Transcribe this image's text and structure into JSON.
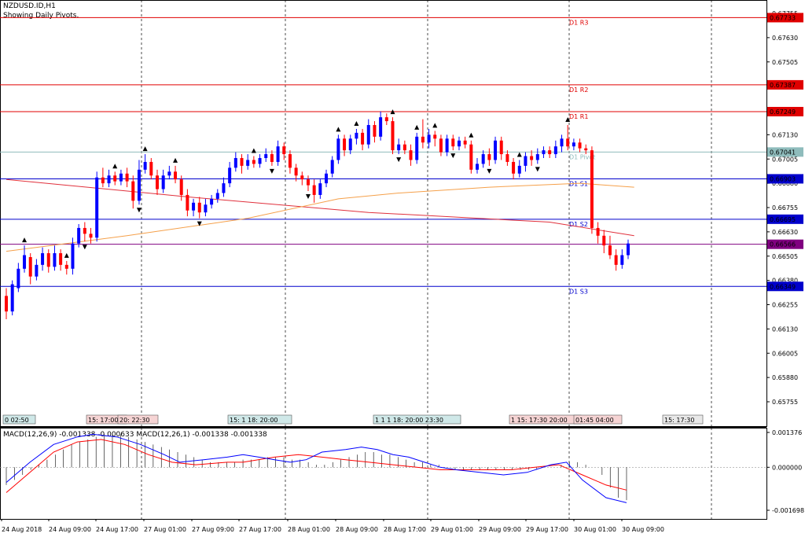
{
  "header": {
    "symbol": "NZDUSD.ID,H1",
    "subtitle": "Showing Daily Pivots.",
    "macd_label": "MACD(12,26,9) -0.001338 -0.000633 MACD(12,26,1) -0.001338 -0.001338"
  },
  "colors": {
    "bull": "#0000ff",
    "bear": "#ff0000",
    "resistance": "#e00000",
    "pivot": "#8fbcbc",
    "support": "#0000cc",
    "current": "#800080",
    "ma_slow": "#e0303c",
    "ma_fast": "#f5a04a",
    "macd_line": "#0000ff",
    "macd_signal": "#ff0000"
  },
  "chart_data": {
    "type": "candlestick",
    "y_ticks": [
      "0.67755",
      "0.67630",
      "0.67505",
      "0.67380",
      "0.67255",
      "0.67130",
      "0.67005",
      "0.66880",
      "0.66755",
      "0.66630",
      "0.66505",
      "0.66380",
      "0.66255",
      "0.66130",
      "0.66005",
      "0.65880",
      "0.65755"
    ],
    "macd_ticks": [
      "0.001376",
      "0.000000",
      "-0.001698"
    ],
    "x_labels": [
      "24 Aug 2018",
      "24 Aug 09:00",
      "24 Aug 17:00",
      "27 Aug 01:00",
      "27 Aug 09:00",
      "27 Aug 17:00",
      "28 Aug 01:00",
      "28 Aug 09:00",
      "28 Aug 17:00",
      "29 Aug 01:00",
      "29 Aug 09:00",
      "29 Aug 17:00",
      "30 Aug 01:00",
      "30 Aug 09:00"
    ],
    "pivots": [
      {
        "name": "D1 R3",
        "value": "0.67733",
        "kind": "resistance"
      },
      {
        "name": "D1 R2",
        "value": "0.67387",
        "kind": "resistance"
      },
      {
        "name": "D1 R1",
        "value": "0.67249",
        "kind": "resistance"
      },
      {
        "name": "D1 Pivot",
        "value": "0.67041",
        "kind": "pivot"
      },
      {
        "name": "D1 S1",
        "value": "0.66903",
        "kind": "support"
      },
      {
        "name": "D1 S2",
        "value": "0.66695",
        "kind": "support"
      },
      {
        "name": "D1 S3",
        "value": "0.66349",
        "kind": "support"
      }
    ],
    "current_price": "0.66566",
    "session_boxes": [
      "0 02:50",
      "15: 17:00",
      "20: 22:30",
      "15: 1 18: 20:00",
      "1 1 1 18: 20:00 23:30",
      "1 15: 17:30 20:00",
      "01:45 04:00",
      "15: 17:30"
    ],
    "candles": [
      [
        0.663,
        0.6622,
        0.6634,
        0.6618
      ],
      [
        0.6622,
        0.6636,
        0.6638,
        0.662
      ],
      [
        0.6634,
        0.6644,
        0.6647,
        0.6632
      ],
      [
        0.6644,
        0.6651,
        0.6656,
        0.6642
      ],
      [
        0.665,
        0.664,
        0.6652,
        0.6636
      ],
      [
        0.664,
        0.6646,
        0.6649,
        0.6638
      ],
      [
        0.6646,
        0.6652,
        0.6655,
        0.6643
      ],
      [
        0.6652,
        0.6645,
        0.6654,
        0.6642
      ],
      [
        0.6645,
        0.6652,
        0.6656,
        0.6643
      ],
      [
        0.6652,
        0.6646,
        0.6654,
        0.6643
      ],
      [
        0.6646,
        0.6644,
        0.6648,
        0.6641
      ],
      [
        0.6644,
        0.6657,
        0.666,
        0.6641
      ],
      [
        0.6657,
        0.6665,
        0.6667,
        0.6655
      ],
      [
        0.6665,
        0.6662,
        0.6668,
        0.6658
      ],
      [
        0.6662,
        0.666,
        0.6665,
        0.6657
      ],
      [
        0.666,
        0.6691,
        0.6694,
        0.6658
      ],
      [
        0.6691,
        0.6688,
        0.6696,
        0.6686
      ],
      [
        0.6688,
        0.6692,
        0.6695,
        0.6686
      ],
      [
        0.6692,
        0.6689,
        0.6694,
        0.6687
      ],
      [
        0.6689,
        0.6693,
        0.6695,
        0.6687
      ],
      [
        0.6693,
        0.6689,
        0.6696,
        0.6686
      ],
      [
        0.6689,
        0.6679,
        0.6692,
        0.6675
      ],
      [
        0.6679,
        0.6695,
        0.67,
        0.6677
      ],
      [
        0.6695,
        0.6699,
        0.6703,
        0.6693
      ],
      [
        0.6699,
        0.6692,
        0.6701,
        0.669
      ],
      [
        0.6692,
        0.6685,
        0.6695,
        0.6682
      ],
      [
        0.6685,
        0.6692,
        0.6695,
        0.6683
      ],
      [
        0.6692,
        0.6694,
        0.6697,
        0.669
      ],
      [
        0.6694,
        0.669,
        0.6697,
        0.6688
      ],
      [
        0.669,
        0.6682,
        0.6692,
        0.6679
      ],
      [
        0.6682,
        0.6674,
        0.6685,
        0.6671
      ],
      [
        0.6674,
        0.6678,
        0.668,
        0.6671
      ],
      [
        0.6678,
        0.6673,
        0.6681,
        0.667
      ],
      [
        0.6673,
        0.6677,
        0.668,
        0.6671
      ],
      [
        0.6677,
        0.668,
        0.6682,
        0.6675
      ],
      [
        0.668,
        0.6683,
        0.6685,
        0.6678
      ],
      [
        0.6683,
        0.6688,
        0.6691,
        0.6681
      ],
      [
        0.6688,
        0.6696,
        0.6699,
        0.6686
      ],
      [
        0.6696,
        0.6701,
        0.6704,
        0.6694
      ],
      [
        0.6701,
        0.6697,
        0.6703,
        0.6693
      ],
      [
        0.6697,
        0.67,
        0.6703,
        0.6695
      ],
      [
        0.67,
        0.6698,
        0.6702,
        0.6696
      ],
      [
        0.6698,
        0.6701,
        0.6703,
        0.6696
      ],
      [
        0.6701,
        0.6703,
        0.6706,
        0.6699
      ],
      [
        0.6703,
        0.6699,
        0.6705,
        0.6697
      ],
      [
        0.6699,
        0.6707,
        0.671,
        0.6697
      ],
      [
        0.6707,
        0.6703,
        0.6709,
        0.67
      ],
      [
        0.6703,
        0.6696,
        0.6705,
        0.6693
      ],
      [
        0.6696,
        0.6692,
        0.6698,
        0.6689
      ],
      [
        0.6692,
        0.669,
        0.6694,
        0.6687
      ],
      [
        0.669,
        0.6687,
        0.6692,
        0.6684
      ],
      [
        0.6687,
        0.6682,
        0.669,
        0.6678
      ],
      [
        0.6682,
        0.6688,
        0.669,
        0.668
      ],
      [
        0.6688,
        0.6693,
        0.6695,
        0.6686
      ],
      [
        0.6693,
        0.67,
        0.6702,
        0.6691
      ],
      [
        0.67,
        0.6711,
        0.6713,
        0.6698
      ],
      [
        0.6711,
        0.6705,
        0.6713,
        0.6702
      ],
      [
        0.6705,
        0.6711,
        0.6713,
        0.6703
      ],
      [
        0.6711,
        0.6714,
        0.6716,
        0.6708
      ],
      [
        0.6714,
        0.6708,
        0.6716,
        0.6705
      ],
      [
        0.6708,
        0.6718,
        0.6721,
        0.6706
      ],
      [
        0.6718,
        0.6712,
        0.672,
        0.6709
      ],
      [
        0.6712,
        0.6722,
        0.6725,
        0.671
      ],
      [
        0.6722,
        0.672,
        0.6724,
        0.6718
      ],
      [
        0.672,
        0.6705,
        0.6722,
        0.6703
      ],
      [
        0.6705,
        0.6708,
        0.6711,
        0.6703
      ],
      [
        0.6708,
        0.6705,
        0.671,
        0.6703
      ],
      [
        0.6705,
        0.67,
        0.6708,
        0.6697
      ],
      [
        0.67,
        0.6712,
        0.6714,
        0.6698
      ],
      [
        0.6712,
        0.6709,
        0.6721,
        0.6706
      ],
      [
        0.6709,
        0.6713,
        0.6716,
        0.6706
      ],
      [
        0.6713,
        0.6711,
        0.6715,
        0.6707
      ],
      [
        0.6711,
        0.6704,
        0.6713,
        0.6702
      ],
      [
        0.6704,
        0.6711,
        0.6713,
        0.6702
      ],
      [
        0.6711,
        0.6707,
        0.6713,
        0.6705
      ],
      [
        0.6707,
        0.671,
        0.6712,
        0.6705
      ],
      [
        0.671,
        0.6708,
        0.6712,
        0.6706
      ],
      [
        0.6708,
        0.6695,
        0.671,
        0.6693
      ],
      [
        0.6695,
        0.6698,
        0.6701,
        0.6693
      ],
      [
        0.6698,
        0.6703,
        0.6705,
        0.6696
      ],
      [
        0.6703,
        0.67,
        0.6706,
        0.6697
      ],
      [
        0.67,
        0.671,
        0.6712,
        0.6698
      ],
      [
        0.671,
        0.6703,
        0.6712,
        0.67
      ],
      [
        0.6703,
        0.6699,
        0.6705,
        0.6697
      ],
      [
        0.6699,
        0.6693,
        0.6701,
        0.669
      ],
      [
        0.6693,
        0.6697,
        0.67,
        0.6691
      ],
      [
        0.6697,
        0.6702,
        0.6704,
        0.6694
      ],
      [
        0.6702,
        0.67,
        0.6705,
        0.6697
      ],
      [
        0.67,
        0.6703,
        0.6706,
        0.6698
      ],
      [
        0.6703,
        0.6705,
        0.6707,
        0.6701
      ],
      [
        0.6705,
        0.6703,
        0.6707,
        0.6701
      ],
      [
        0.6703,
        0.6707,
        0.671,
        0.6701
      ],
      [
        0.6707,
        0.6711,
        0.6713,
        0.6704
      ],
      [
        0.6711,
        0.6707,
        0.6718,
        0.6705
      ],
      [
        0.6707,
        0.6709,
        0.6711,
        0.6705
      ],
      [
        0.6709,
        0.6706,
        0.6711,
        0.6704
      ],
      [
        0.6706,
        0.6705,
        0.6708,
        0.6703
      ],
      [
        0.6705,
        0.6665,
        0.6707,
        0.6662
      ],
      [
        0.6665,
        0.6661,
        0.6668,
        0.6657
      ],
      [
        0.6661,
        0.6656,
        0.6664,
        0.6652
      ],
      [
        0.6656,
        0.6651,
        0.6661,
        0.6649
      ],
      [
        0.6651,
        0.6646,
        0.6654,
        0.6643
      ],
      [
        0.6646,
        0.6651,
        0.6654,
        0.6644
      ],
      [
        0.6651,
        0.6657,
        0.6659,
        0.6649
      ]
    ],
    "fractals": [
      {
        "i": 3,
        "dir": "up"
      },
      {
        "i": 10,
        "dir": "up"
      },
      {
        "i": 13,
        "dir": "down"
      },
      {
        "i": 18,
        "dir": "up"
      },
      {
        "i": 23,
        "dir": "up"
      },
      {
        "i": 22,
        "dir": "down"
      },
      {
        "i": 28,
        "dir": "up"
      },
      {
        "i": 32,
        "dir": "down"
      },
      {
        "i": 41,
        "dir": "up"
      },
      {
        "i": 44,
        "dir": "down"
      },
      {
        "i": 50,
        "dir": "down"
      },
      {
        "i": 55,
        "dir": "up"
      },
      {
        "i": 58,
        "dir": "up"
      },
      {
        "i": 64,
        "dir": "up"
      },
      {
        "i": 65,
        "dir": "down"
      },
      {
        "i": 68,
        "dir": "up"
      },
      {
        "i": 71,
        "dir": "up"
      },
      {
        "i": 74,
        "dir": "down"
      },
      {
        "i": 77,
        "dir": "up"
      },
      {
        "i": 80,
        "dir": "down"
      },
      {
        "i": 85,
        "dir": "up"
      },
      {
        "i": 88,
        "dir": "down"
      },
      {
        "i": 93,
        "dir": "up"
      }
    ],
    "ma_slow": [
      [
        0,
        0.669
      ],
      [
        30,
        0.6681
      ],
      [
        60,
        0.6673
      ],
      [
        90,
        0.6668
      ],
      [
        104,
        0.6661
      ]
    ],
    "ma_fast": [
      [
        0,
        0.6653
      ],
      [
        20,
        0.6661
      ],
      [
        40,
        0.667
      ],
      [
        55,
        0.668
      ],
      [
        65,
        0.6683
      ],
      [
        80,
        0.6686
      ],
      [
        95,
        0.6688
      ],
      [
        104,
        0.6686
      ]
    ],
    "macd_hist": [
      -0.0007,
      -0.0005,
      -0.0003,
      -0.0001,
      0.0001,
      0.0003,
      0.0005,
      0.0007,
      0.0009,
      0.001,
      0.0011,
      0.0012,
      0.0013,
      0.0013,
      0.0013,
      0.0012,
      0.0011,
      0.001,
      0.0009,
      0.0008,
      0.0007,
      0.0006,
      0.0005,
      0.0004,
      0.0003,
      0.0002,
      0.0002,
      0.0002,
      0.0002,
      0.0003,
      0.0003,
      0.0003,
      0.0004,
      0.0004,
      0.0004,
      0.0003,
      0.0003,
      0.0002,
      0.0001,
      0.0001,
      0.0002,
      0.0003,
      0.0004,
      0.0005,
      0.0006,
      0.0006,
      0.0005,
      0.0005,
      0.0004,
      0.0003,
      0.0002,
      0.0002,
      0.0001,
      0.0001,
      0.0,
      -0.0001,
      -0.0001,
      -0.0001,
      -0.0001,
      -0.0001,
      -0.0001,
      -0.0001,
      -0.0001,
      -0.0001,
      -0.0001,
      -0.0001,
      0.0,
      0.0,
      0.0001,
      0.0002,
      0.0002,
      0.0001,
      0.0,
      -0.0003,
      -0.0008,
      -0.0012,
      -0.0013
    ],
    "macd_signal": [
      [
        0,
        -0.001
      ],
      [
        15,
        -0.0002
      ],
      [
        30,
        0.0006
      ],
      [
        45,
        0.001
      ],
      [
        60,
        0.0011
      ],
      [
        75,
        0.0009
      ],
      [
        90,
        0.0005
      ],
      [
        105,
        0.0002
      ],
      [
        120,
        0.0001
      ],
      [
        140,
        0.0002
      ],
      [
        150,
        0.0002
      ],
      [
        170,
        0.0004
      ],
      [
        185,
        0.0005
      ],
      [
        200,
        0.0004
      ],
      [
        215,
        0.0003
      ],
      [
        230,
        0.0002
      ],
      [
        245,
        0.0001
      ],
      [
        260,
        0.0
      ],
      [
        275,
        -0.0001
      ],
      [
        290,
        -0.0001
      ],
      [
        305,
        -0.0001
      ],
      [
        320,
        -0.0001
      ],
      [
        335,
        0.0
      ],
      [
        350,
        0.0001
      ],
      [
        365,
        -0.0003
      ],
      [
        380,
        -0.0007
      ],
      [
        393,
        -0.0009
      ]
    ],
    "macd_main": [
      [
        0,
        -0.0006
      ],
      [
        15,
        0.0002
      ],
      [
        30,
        0.0009
      ],
      [
        45,
        0.0012
      ],
      [
        55,
        0.0013
      ],
      [
        70,
        0.0012
      ],
      [
        85,
        0.0009
      ],
      [
        100,
        0.0005
      ],
      [
        110,
        0.0002
      ],
      [
        125,
        0.0003
      ],
      [
        140,
        0.0004
      ],
      [
        150,
        0.0005
      ],
      [
        160,
        0.0004
      ],
      [
        170,
        0.0003
      ],
      [
        180,
        0.0002
      ],
      [
        190,
        0.0003
      ],
      [
        200,
        0.0006
      ],
      [
        215,
        0.0007
      ],
      [
        225,
        0.0008
      ],
      [
        235,
        0.0007
      ],
      [
        245,
        0.0005
      ],
      [
        255,
        0.0004
      ],
      [
        265,
        0.0002
      ],
      [
        275,
        0.0
      ],
      [
        285,
        -0.0001
      ],
      [
        300,
        -0.0002
      ],
      [
        315,
        -0.0003
      ],
      [
        330,
        -0.0002
      ],
      [
        345,
        0.0001
      ],
      [
        355,
        0.0002
      ],
      [
        365,
        -0.0005
      ],
      [
        380,
        -0.0012
      ],
      [
        393,
        -0.0014
      ]
    ]
  }
}
